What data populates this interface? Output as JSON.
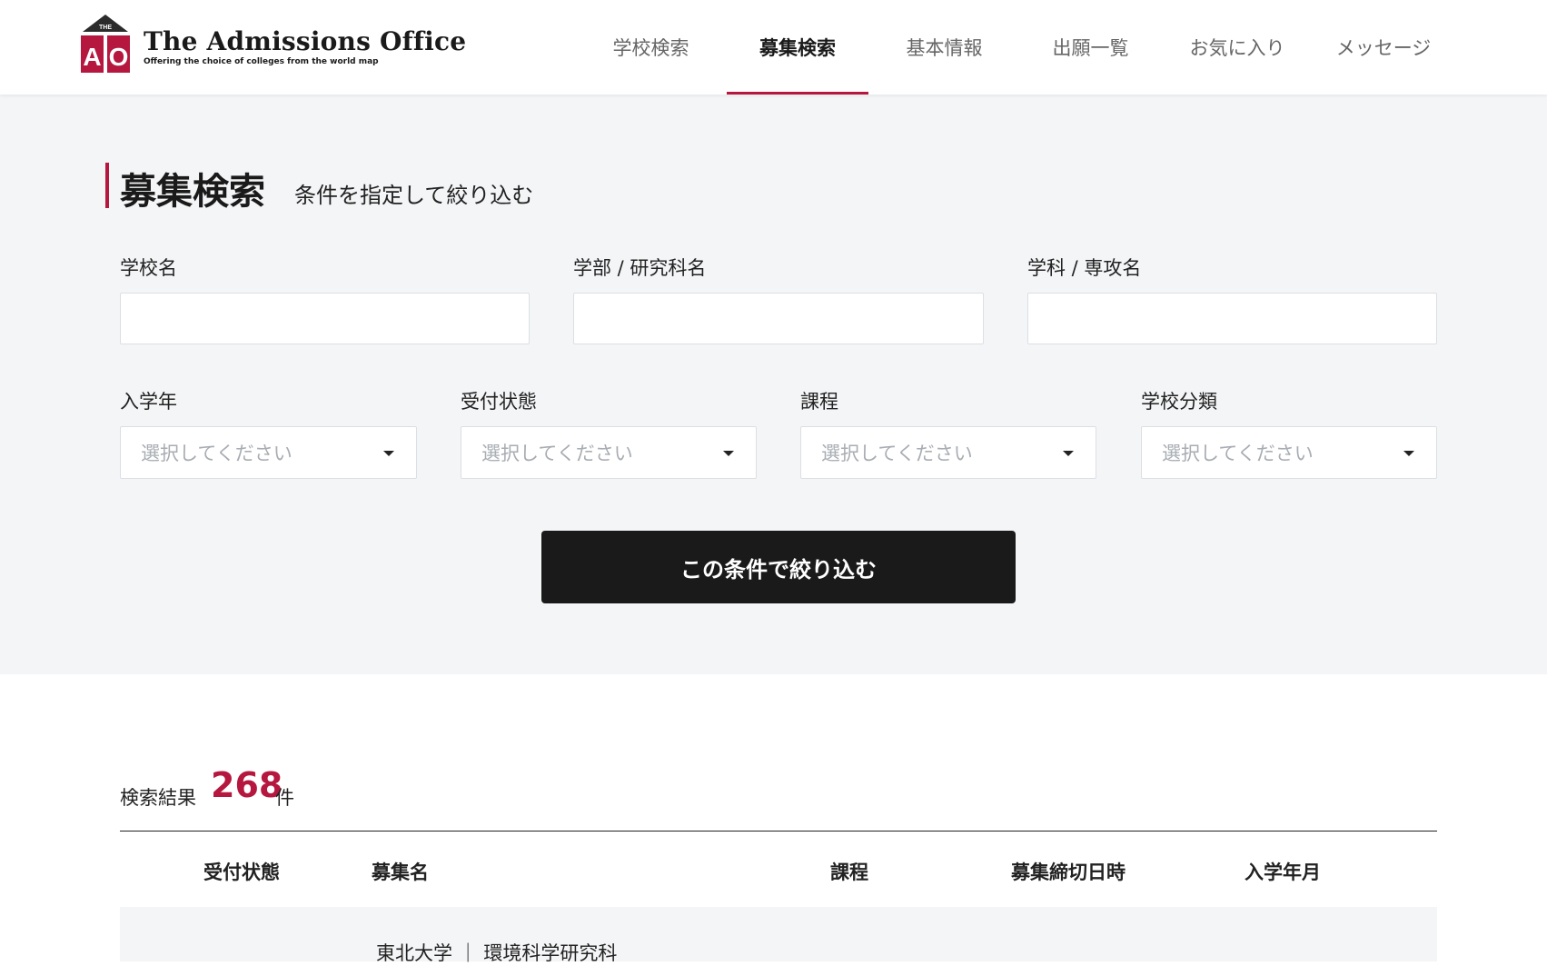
{
  "header": {
    "logo": {
      "mark_top": "THE",
      "mark_letters": "AO",
      "title": "The Admissions Office",
      "subtitle": "Offering the choice of colleges from the world map"
    },
    "nav": [
      {
        "label": "学校検索",
        "active": false
      },
      {
        "label": "募集検索",
        "active": true
      },
      {
        "label": "基本情報",
        "active": false
      },
      {
        "label": "出願一覧",
        "active": false
      },
      {
        "label": "お気に入り",
        "active": false
      },
      {
        "label": "メッセージ",
        "active": false
      }
    ]
  },
  "search": {
    "title": "募集検索",
    "subtitle": "条件を指定して絞り込む",
    "fields": {
      "school_name": {
        "label": "学校名",
        "value": ""
      },
      "faculty_name": {
        "label": "学部 / 研究科名",
        "value": ""
      },
      "department_name": {
        "label": "学科 / 専攻名",
        "value": ""
      }
    },
    "selects": {
      "enrollment_year": {
        "label": "入学年",
        "placeholder": "選択してください"
      },
      "reception_status": {
        "label": "受付状態",
        "placeholder": "選択してください"
      },
      "course": {
        "label": "課程",
        "placeholder": "選択してください"
      },
      "school_category": {
        "label": "学校分類",
        "placeholder": "選択してください"
      }
    },
    "submit_label": "この条件で絞り込む"
  },
  "results": {
    "label": "検索結果",
    "count": "268",
    "unit": "件",
    "columns": [
      "受付状態",
      "募集名",
      "課程",
      "募集締切日時",
      "入学年月"
    ],
    "rows": [
      {
        "name": "東北大学 ｜ 環境科学研究科"
      }
    ]
  },
  "colors": {
    "accent": "#b5173f",
    "button_bg": "#1a1a1a",
    "section_bg": "#f4f5f7"
  }
}
